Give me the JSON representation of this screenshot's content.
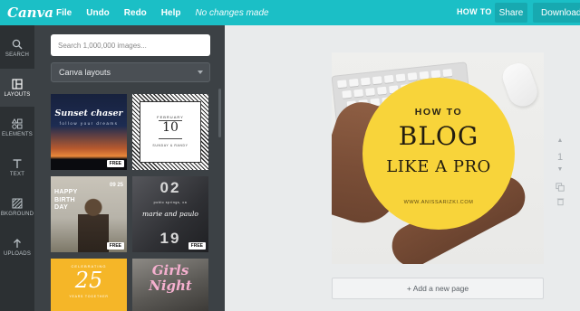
{
  "topbar": {
    "logo": "Canva",
    "menu": [
      "File",
      "Undo",
      "Redo",
      "Help"
    ],
    "status": "No changes made",
    "how_to": "HOW TO",
    "share_label": "Share",
    "download_label": "Download",
    "accent_color": "#1bbfc6"
  },
  "rail": {
    "items": [
      {
        "label": "SEARCH",
        "icon": "search-icon"
      },
      {
        "label": "LAYOUTS",
        "icon": "layouts-icon",
        "active": true
      },
      {
        "label": "ELEMENTS",
        "icon": "elements-icon"
      },
      {
        "label": "TEXT",
        "icon": "text-icon"
      },
      {
        "label": "BKGROUND",
        "icon": "background-icon"
      },
      {
        "label": "UPLOADS",
        "icon": "upload-icon"
      }
    ]
  },
  "panel": {
    "search_placeholder": "Search 1,000,000 images...",
    "dropdown_value": "Canva layouts",
    "templates": {
      "sunset": {
        "title": "Sunset chaser",
        "subtitle": "follow your dreams",
        "badge": "FREE"
      },
      "calendar": {
        "month": "FEBRUARY",
        "day": "10",
        "names": "SUNDAY & RANDY"
      },
      "birthday": {
        "text": "HAPPY BIRTH DAY",
        "date": "09 25",
        "badge": "FREE"
      },
      "wedding": {
        "top": "02",
        "names": "marie and paulo",
        "place": "poblo springs, ca",
        "bottom": "19",
        "badge": "FREE"
      },
      "yellow": {
        "top": "CELEBRATING",
        "number": "25",
        "sub": "YEARS TOGETHER"
      },
      "girls": {
        "line1": "Girls",
        "line2": "Night"
      }
    }
  },
  "design": {
    "how_to": "HOW TO",
    "blog": "BLOG",
    "like_a_pro": "LIKE A PRO",
    "url": "WWW.ANISSARIZKI.COM",
    "circle_color": "#f8d43a"
  },
  "page_number": "1",
  "add_page_label": "+ Add a new page"
}
